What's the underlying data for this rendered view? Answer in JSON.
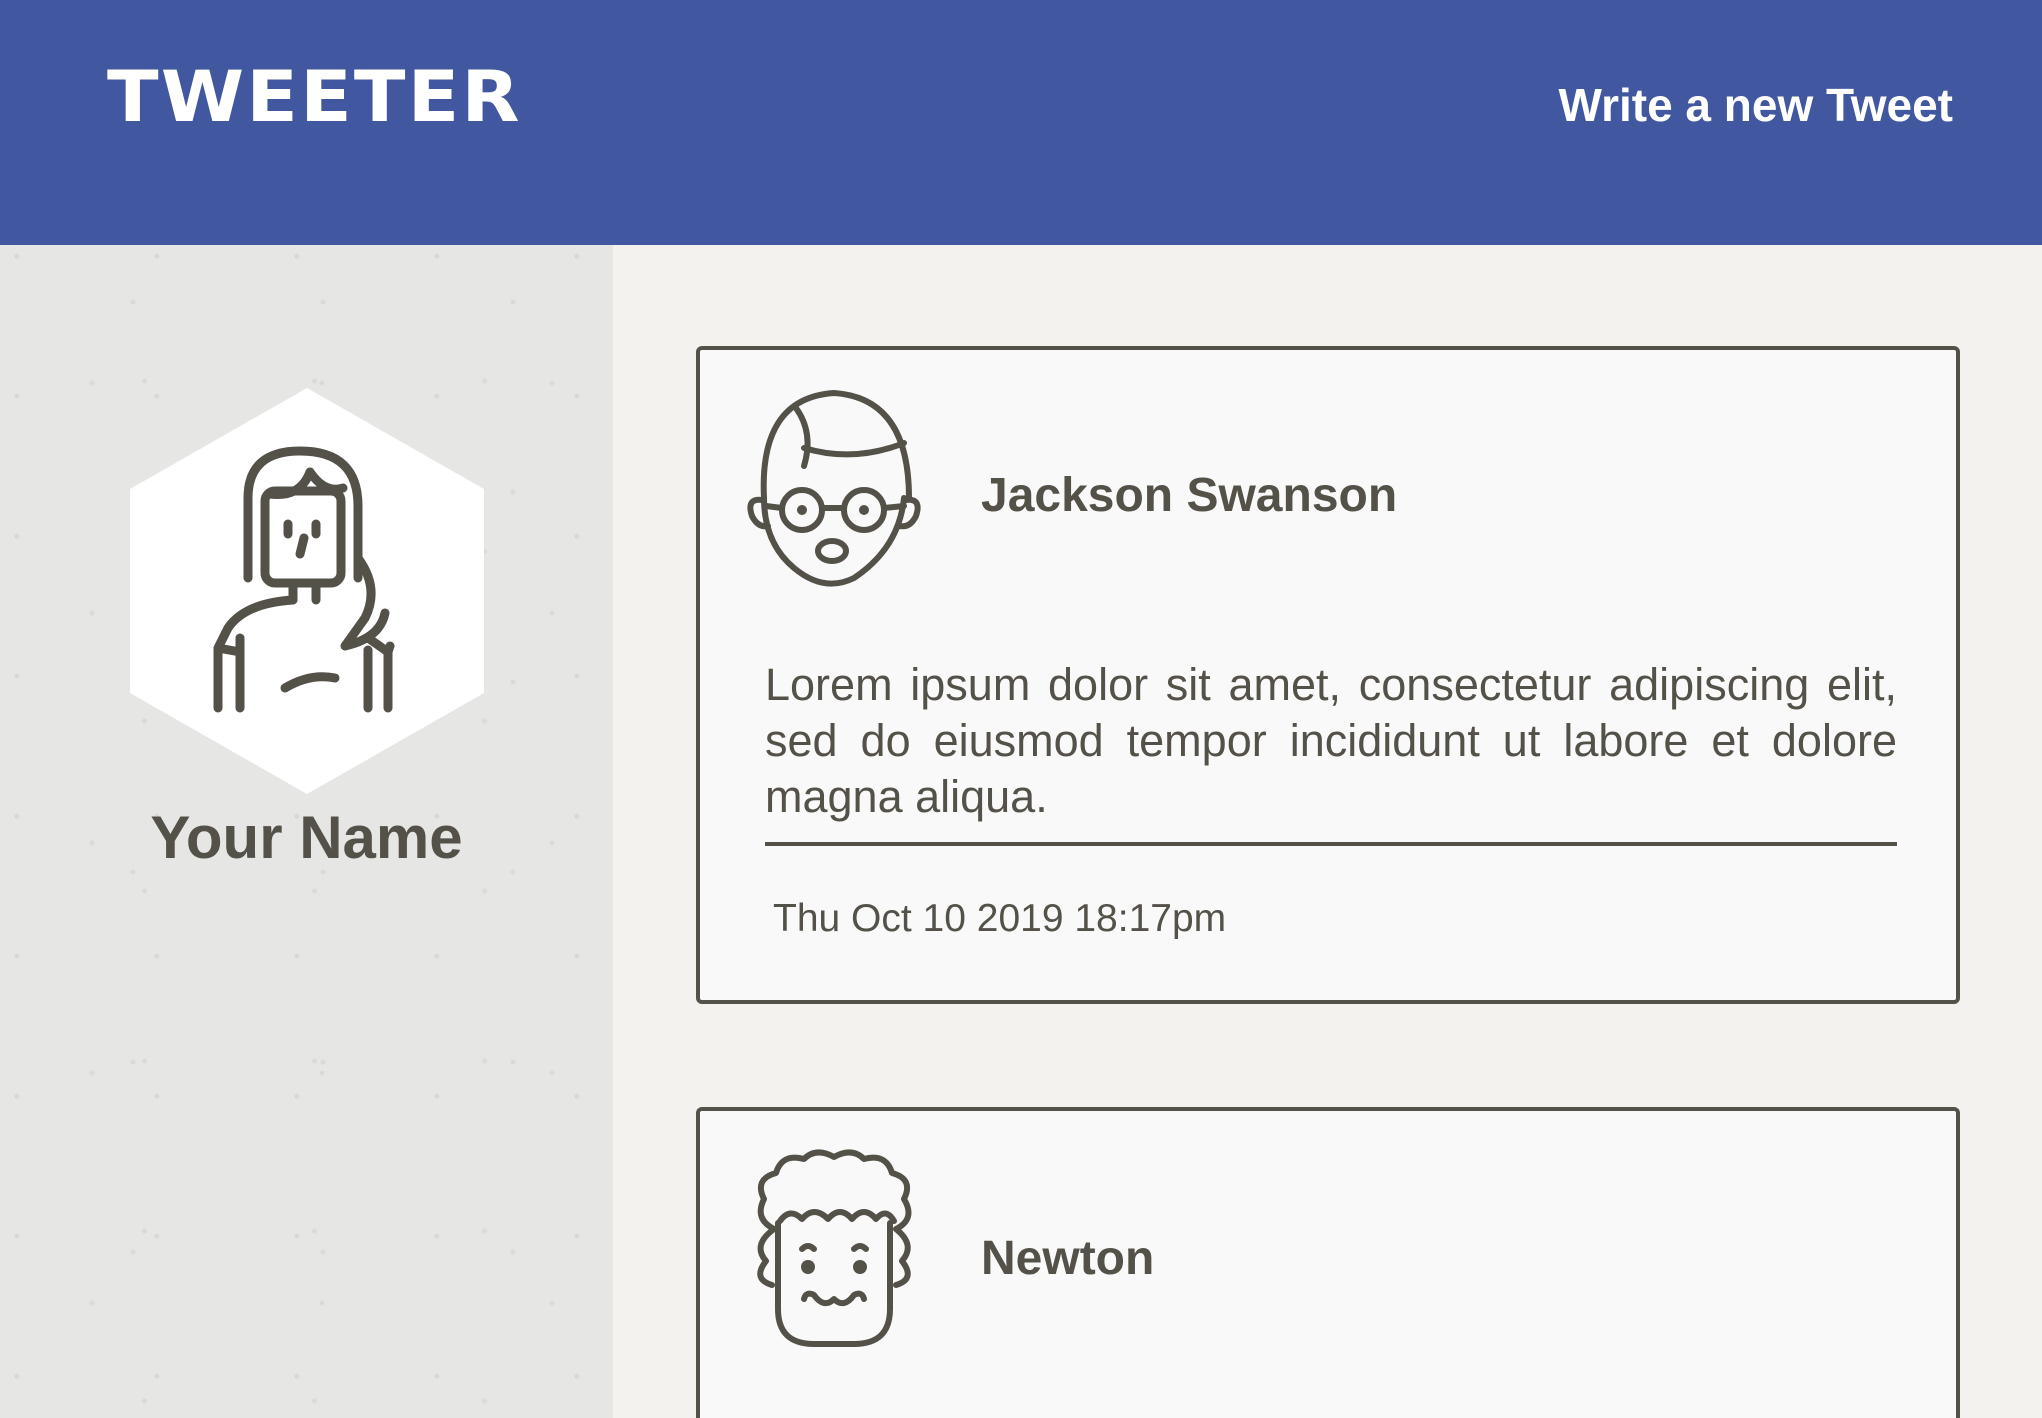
{
  "nav": {
    "brand": "TWEETER",
    "compose_label": "Write a new Tweet"
  },
  "profile": {
    "name": "Your Name",
    "avatar_icon": "female-avatar-icon"
  },
  "tweets": [
    {
      "author": "Jackson Swanson",
      "avatar_icon": "glasses-avatar-icon",
      "content": "Lorem ipsum dolor sit amet, consectetur adipiscing elit, sed do eiusmod tempor incididunt ut labore et dolore magna aliqua.",
      "timestamp": "Thu Oct 10 2019 18:17pm"
    },
    {
      "author": "Newton",
      "avatar_icon": "curly-hair-avatar-icon"
    }
  ],
  "colors": {
    "nav_background": "#4158a0",
    "text": "#545149",
    "feed_background": "#f4f2ee",
    "card_background": "#f8f9f8"
  }
}
